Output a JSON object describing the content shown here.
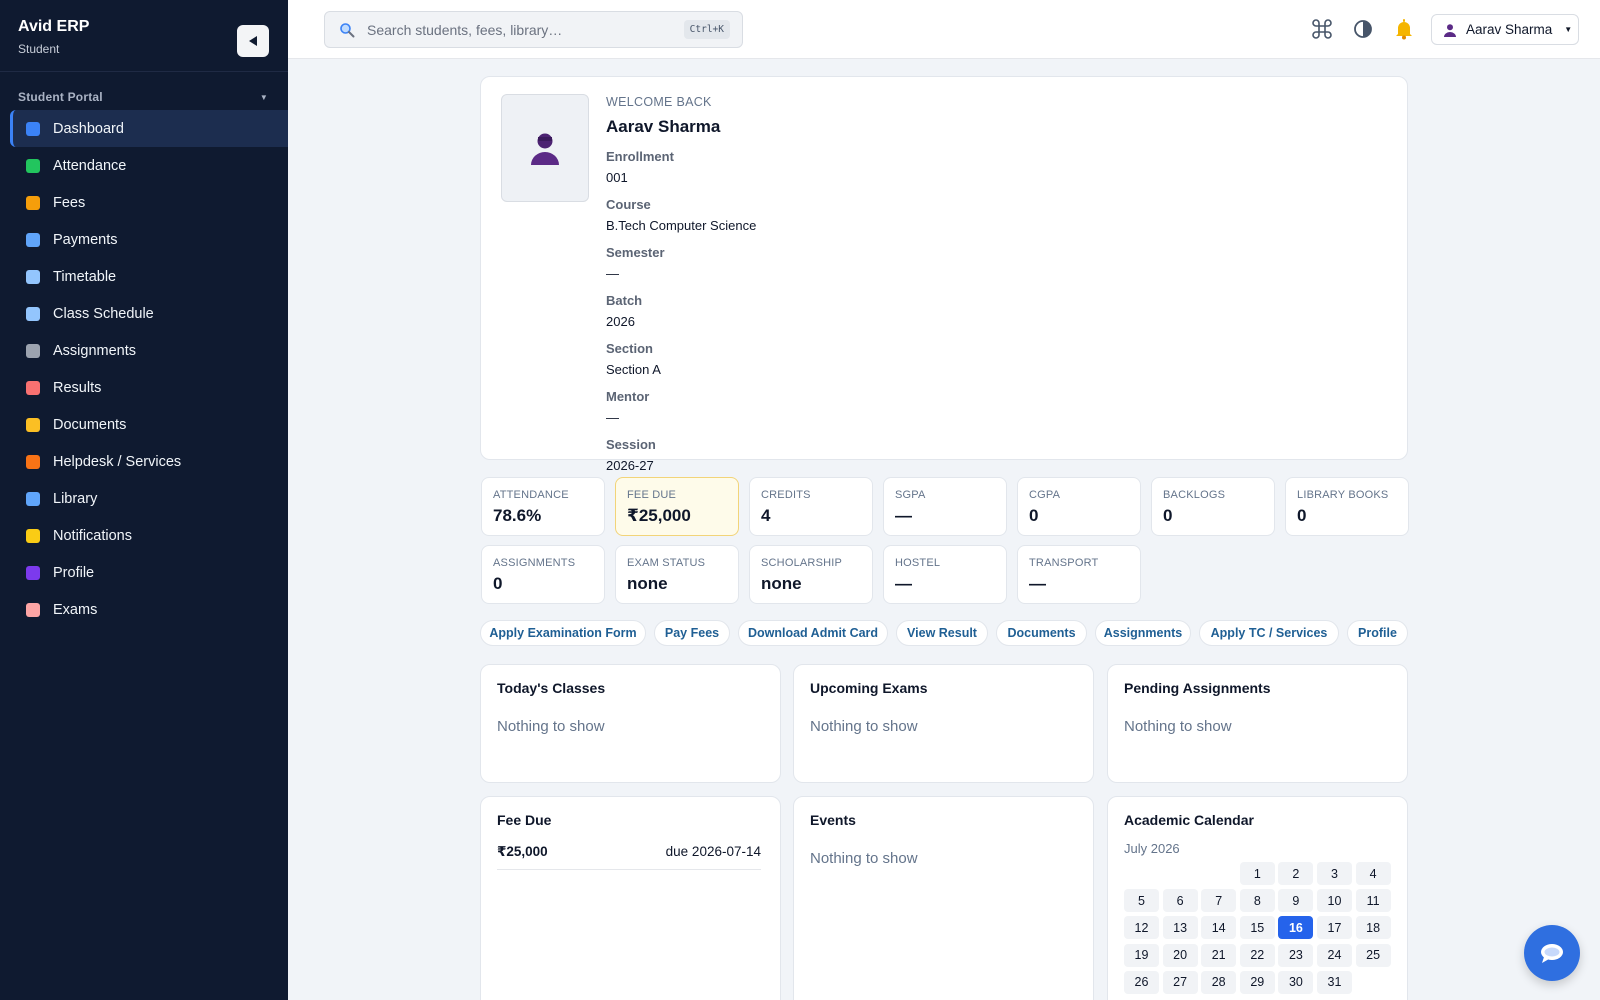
{
  "app": {
    "name": "Avid ERP",
    "role": "Student"
  },
  "sidebar": {
    "section_label": "Student Portal",
    "items": [
      {
        "label": "Dashboard",
        "icon": "bar-chart-icon",
        "color": "#3b82f6",
        "active": true
      },
      {
        "label": "Attendance",
        "icon": "check-box-icon",
        "color": "#22c55e"
      },
      {
        "label": "Fees",
        "icon": "money-bag-icon",
        "color": "#f59e0b"
      },
      {
        "label": "Payments",
        "icon": "credit-card-icon",
        "color": "#60a5fa"
      },
      {
        "label": "Timetable",
        "icon": "calendar-icon",
        "color": "#93c5fd"
      },
      {
        "label": "Class Schedule",
        "icon": "calendar-icon",
        "color": "#93c5fd"
      },
      {
        "label": "Assignments",
        "icon": "paperclip-icon",
        "color": "#9ca3af"
      },
      {
        "label": "Results",
        "icon": "receipt-icon",
        "color": "#f87171"
      },
      {
        "label": "Documents",
        "icon": "folder-icon",
        "color": "#fbbf24"
      },
      {
        "label": "Helpdesk / Services",
        "icon": "bell-service-icon",
        "color": "#f97316"
      },
      {
        "label": "Library",
        "icon": "book-icon",
        "color": "#60a5fa"
      },
      {
        "label": "Notifications",
        "icon": "bell-icon",
        "color": "#facc15"
      },
      {
        "label": "Profile",
        "icon": "person-icon",
        "color": "#7c3aed"
      },
      {
        "label": "Exams",
        "icon": "memo-icon",
        "color": "#fca5a5"
      }
    ]
  },
  "topbar": {
    "search_placeholder": "Search students, fees, library…",
    "search_shortcut": "Ctrl+K",
    "user_name": "Aarav Sharma"
  },
  "profile": {
    "welcome": "WELCOME BACK",
    "name": "Aarav Sharma",
    "fields": [
      {
        "label": "Enrollment",
        "value": "001"
      },
      {
        "label": "Course",
        "value": "B.Tech Computer Science"
      },
      {
        "label": "Semester",
        "value": "—"
      },
      {
        "label": "Batch",
        "value": "2026"
      },
      {
        "label": "Section",
        "value": "Section A"
      },
      {
        "label": "Mentor",
        "value": "—"
      },
      {
        "label": "Session",
        "value": "2026-27"
      }
    ]
  },
  "stats": [
    {
      "label": "ATTENDANCE",
      "value": "78.6%"
    },
    {
      "label": "FEE DUE",
      "value": "₹25,000",
      "highlight": true
    },
    {
      "label": "CREDITS",
      "value": "4"
    },
    {
      "label": "SGPA",
      "value": "—"
    },
    {
      "label": "CGPA",
      "value": "0"
    },
    {
      "label": "BACKLOGS",
      "value": "0"
    },
    {
      "label": "LIBRARY BOOKS",
      "value": "0"
    },
    {
      "label": "ASSIGNMENTS",
      "value": "0"
    },
    {
      "label": "EXAM STATUS",
      "value": "none"
    },
    {
      "label": "SCHOLARSHIP",
      "value": "none"
    },
    {
      "label": "HOSTEL",
      "value": "—"
    },
    {
      "label": "TRANSPORT",
      "value": "—"
    }
  ],
  "actions": [
    "Apply Examination Form",
    "Pay Fees",
    "Download Admit Card",
    "View Result",
    "Documents",
    "Assignments",
    "Apply TC / Services",
    "Profile"
  ],
  "panels": {
    "todays_classes": {
      "title": "Today's Classes",
      "empty": "Nothing to show"
    },
    "upcoming_exams": {
      "title": "Upcoming Exams",
      "empty": "Nothing to show"
    },
    "pending_assignments": {
      "title": "Pending Assignments",
      "empty": "Nothing to show"
    },
    "fee_due": {
      "title": "Fee Due",
      "amount": "₹25,000",
      "due": "due 2026-07-14"
    },
    "events": {
      "title": "Events",
      "empty": "Nothing to show"
    },
    "calendar": {
      "title": "Academic Calendar",
      "month": "July 2026",
      "first_weekday": 3,
      "days": [
        "1",
        "2",
        "3",
        "4",
        "5",
        "6",
        "7",
        "8",
        "9",
        "10",
        "11",
        "12",
        "13",
        "14",
        "15",
        "16",
        "17",
        "18",
        "19",
        "20",
        "21",
        "22",
        "23",
        "24",
        "25",
        "26",
        "27",
        "28",
        "29",
        "30",
        "31"
      ],
      "today": "16",
      "accent": "#2563eb"
    }
  },
  "colors": {
    "sidebar_bg": "#0f1a30",
    "active_accent": "#3b82f6",
    "pill_text": "#1f5f94",
    "fee_highlight_bg": "#fefbea",
    "fab": "#2f6fe0"
  }
}
